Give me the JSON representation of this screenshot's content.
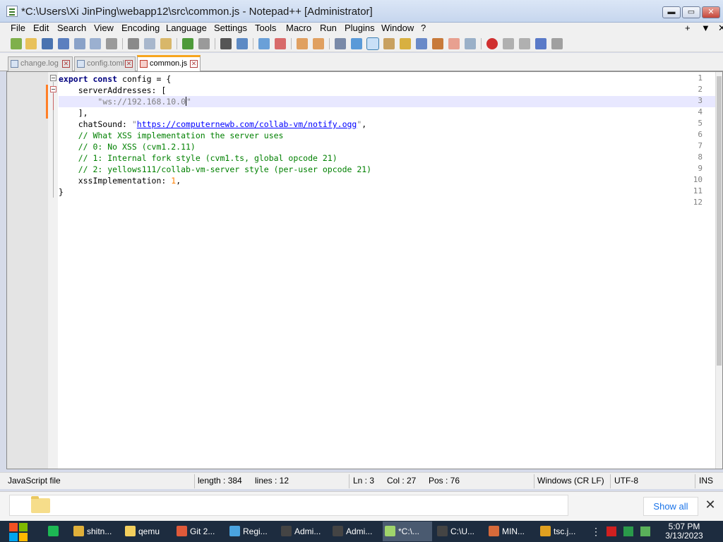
{
  "window": {
    "title": "*C:\\Users\\Xi JinPing\\webapp12\\src\\common.js - Notepad++ [Administrator]",
    "minimize": "▬",
    "maximize": "▭",
    "close": "✕"
  },
  "menu": {
    "items": [
      "File",
      "Edit",
      "Search",
      "View",
      "Encoding",
      "Language",
      "Settings",
      "Tools",
      "Macro",
      "Run",
      "Plugins",
      "Window",
      "?"
    ],
    "right": [
      "+",
      "▼",
      "✕"
    ]
  },
  "tabs": [
    {
      "label": "change.log",
      "active": false
    },
    {
      "label": "config.toml",
      "active": false
    },
    {
      "label": "common.js",
      "active": true
    }
  ],
  "editor": {
    "line_numbers": [
      "1",
      "2",
      "3",
      "4",
      "5",
      "6",
      "7",
      "8",
      "9",
      "10",
      "11",
      "12"
    ],
    "lines": [
      [
        {
          "t": "kw",
          "v": "export const"
        },
        {
          "t": "p",
          "v": " config = {"
        }
      ],
      [
        {
          "t": "p",
          "v": "    serverAddresses: ["
        }
      ],
      [
        {
          "t": "p",
          "v": "        "
        },
        {
          "t": "str",
          "v": "\"ws://192.168.10.0"
        },
        {
          "t": "caret",
          "v": ""
        },
        {
          "t": "str",
          "v": "\""
        }
      ],
      [
        {
          "t": "p",
          "v": "    ],"
        }
      ],
      [
        {
          "t": "p",
          "v": "    chatSound: "
        },
        {
          "t": "str",
          "v": "\""
        },
        {
          "t": "url",
          "v": "https://computernewb.com/collab-vm/notify.ogg"
        },
        {
          "t": "str",
          "v": "\""
        },
        {
          "t": "p",
          "v": ","
        }
      ],
      [
        {
          "t": "cmt",
          "v": "    // What XSS implementation the server uses"
        }
      ],
      [
        {
          "t": "cmt",
          "v": "    // 0: No XSS (cvm1.2.11)"
        }
      ],
      [
        {
          "t": "cmt",
          "v": "    // 1: Internal fork style (cvm1.ts, global opcode 21)"
        }
      ],
      [
        {
          "t": "cmt",
          "v": "    // 2: yellows111/collab-vm-server style (per-user opcode 21)"
        }
      ],
      [
        {
          "t": "p",
          "v": "    xssImplementation: "
        },
        {
          "t": "num",
          "v": "1"
        },
        {
          "t": "p",
          "v": ","
        }
      ],
      [
        {
          "t": "p",
          "v": "}"
        }
      ],
      [
        {
          "t": "p",
          "v": ""
        }
      ]
    ],
    "current_line": 3
  },
  "status": {
    "file_type": "JavaScript file",
    "length": "length : 384",
    "lines": "lines : 12",
    "ln": "Ln : 3",
    "col": "Col : 27",
    "pos": "Pos : 76",
    "eol": "Windows (CR LF)",
    "encoding": "UTF-8",
    "mode": "INS"
  },
  "notification": {
    "show_all": "Show all",
    "close": "✕"
  },
  "taskbar": {
    "items": [
      {
        "label": "",
        "icon_color": "#1db954"
      },
      {
        "label": "shitn...",
        "icon_color": "#e0b03a"
      },
      {
        "label": "qemu",
        "icon_color": "#f3cf5d"
      },
      {
        "label": "Git 2...",
        "icon_color": "#e05a3a"
      },
      {
        "label": "Regi...",
        "icon_color": "#4aa3df"
      },
      {
        "label": "Admi...",
        "icon_color": "#444444"
      },
      {
        "label": "Admi...",
        "icon_color": "#444444"
      },
      {
        "label": "*C:\\...",
        "icon_color": "#9fd46b"
      },
      {
        "label": "C:\\U...",
        "icon_color": "#444444"
      },
      {
        "label": "MIN...",
        "icon_color": "#d66a3a"
      },
      {
        "label": "tsc.j...",
        "icon_color": "#e0a020"
      }
    ],
    "time": "5:07 PM",
    "date": "3/13/2023"
  }
}
